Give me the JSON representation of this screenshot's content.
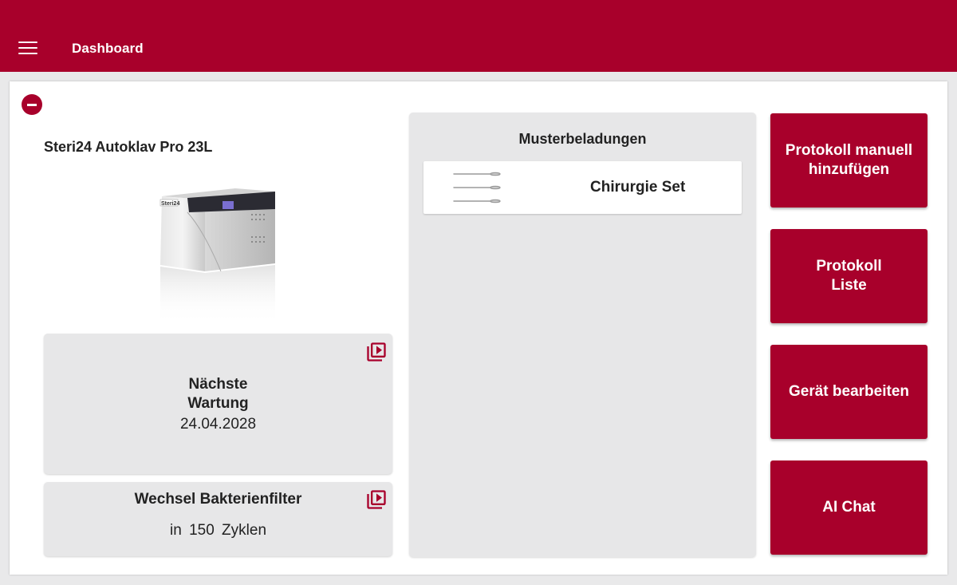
{
  "header": {
    "title": "Dashboard",
    "menu_icon": "hamburger-menu-icon",
    "background_color": "#a8002b"
  },
  "device": {
    "name": "Steri24 Autoklav Pro 23L",
    "brand_label": "Steri24",
    "remove_icon": "minus-circle-icon"
  },
  "maintenance": {
    "title_line1": "Nächste",
    "title_line2": "Wartung",
    "date": "24.04.2028",
    "video_icon": "video-library-icon"
  },
  "filter": {
    "title": "Wechsel Bakterienfilter",
    "prefix": "in",
    "count": "150",
    "unit": "Zyklen",
    "video_icon": "video-library-icon"
  },
  "samples": {
    "title": "Musterbeladungen",
    "items": [
      {
        "label": "Chirurgie Set",
        "icon": "surgical-instruments-icon"
      }
    ]
  },
  "actions": [
    {
      "line1": "Protokoll manuell",
      "line2": "hinzufügen"
    },
    {
      "line1": "Protokoll",
      "line2": "Liste"
    },
    {
      "line1": "Gerät bearbeiten",
      "line2": ""
    },
    {
      "line1": "AI Chat",
      "line2": ""
    }
  ],
  "colors": {
    "accent": "#a8002b",
    "card_background": "#e7e7e8",
    "page_background": "#e9e9ea"
  }
}
